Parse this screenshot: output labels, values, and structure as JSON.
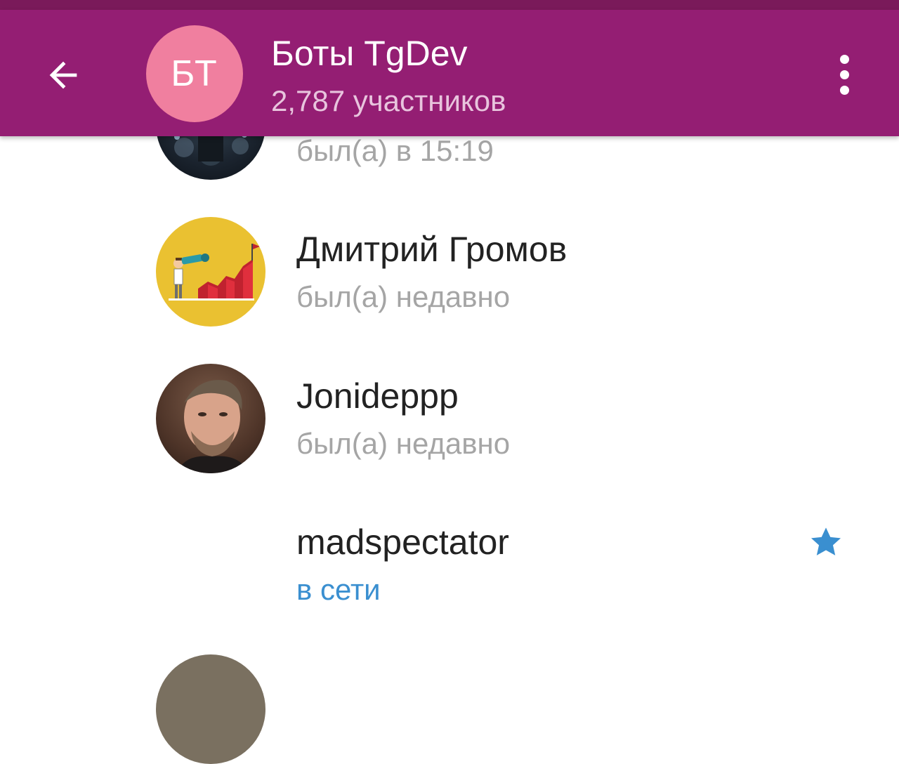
{
  "header": {
    "avatar_initials": "БТ",
    "avatar_color": "#f07f9f",
    "title": "Боты TgDev",
    "subtitle": "2,787 участников",
    "back_icon": "arrow-left-icon",
    "menu_icon": "more-vertical-icon",
    "bar_color": "#941e73"
  },
  "members": [
    {
      "name": "",
      "status": "был(а) в 15:19",
      "avatar": "dark-photo"
    },
    {
      "name": "Дмитрий Громов",
      "status": "был(а) недавно",
      "avatar": "telescope-chart-illustration"
    },
    {
      "name": "Jonideppp",
      "status": "был(а) недавно",
      "avatar": "man-photo"
    },
    {
      "name": "madspectator",
      "status": "в сети",
      "avatar": "",
      "badge_icon": "star-icon",
      "status_color": "#3a8fd0"
    }
  ]
}
